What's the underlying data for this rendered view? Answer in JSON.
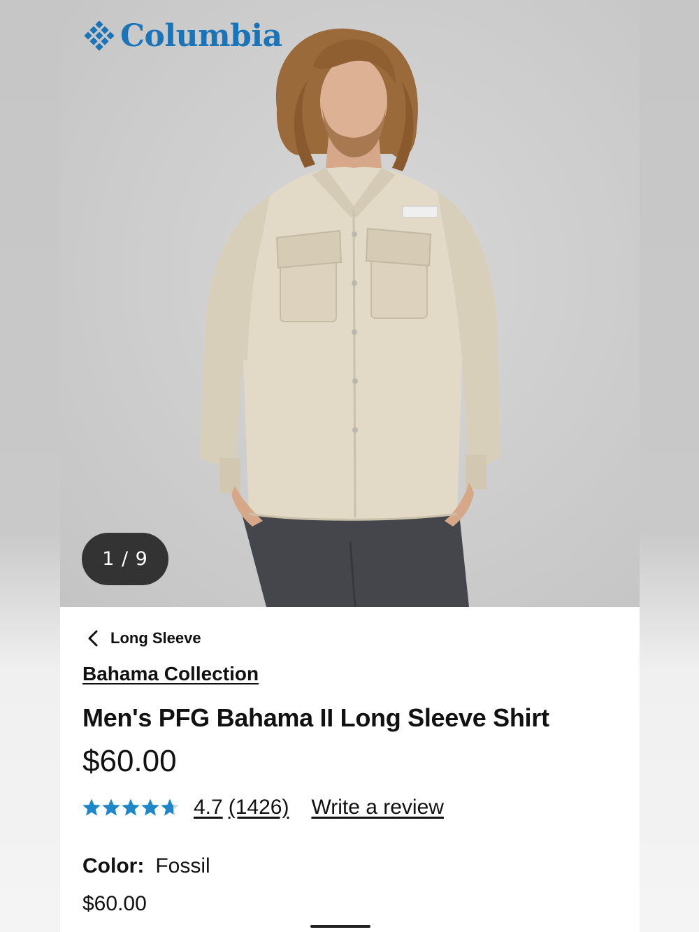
{
  "brand": {
    "name": "Columbia",
    "color": "#1b73b8",
    "icon": "columbia-diamond-logo-icon"
  },
  "gallery": {
    "counter": "1 / 9",
    "current_index": 1,
    "total": 9
  },
  "breadcrumb": {
    "icon": "chevron-left-icon",
    "label": "Long Sleeve"
  },
  "product": {
    "collection": "Bahama Collection",
    "title": "Men's PFG Bahama II Long Sleeve Shirt",
    "price": "$60.00",
    "rating": {
      "value": "4.7",
      "value_numeric": 4.7,
      "max_stars": 5,
      "count": "(1426)",
      "star_color": "#1f86c8",
      "write_review_label": "Write a review"
    },
    "color": {
      "label": "Color:",
      "value": "Fossil"
    },
    "swatch_price": "$60.00"
  }
}
